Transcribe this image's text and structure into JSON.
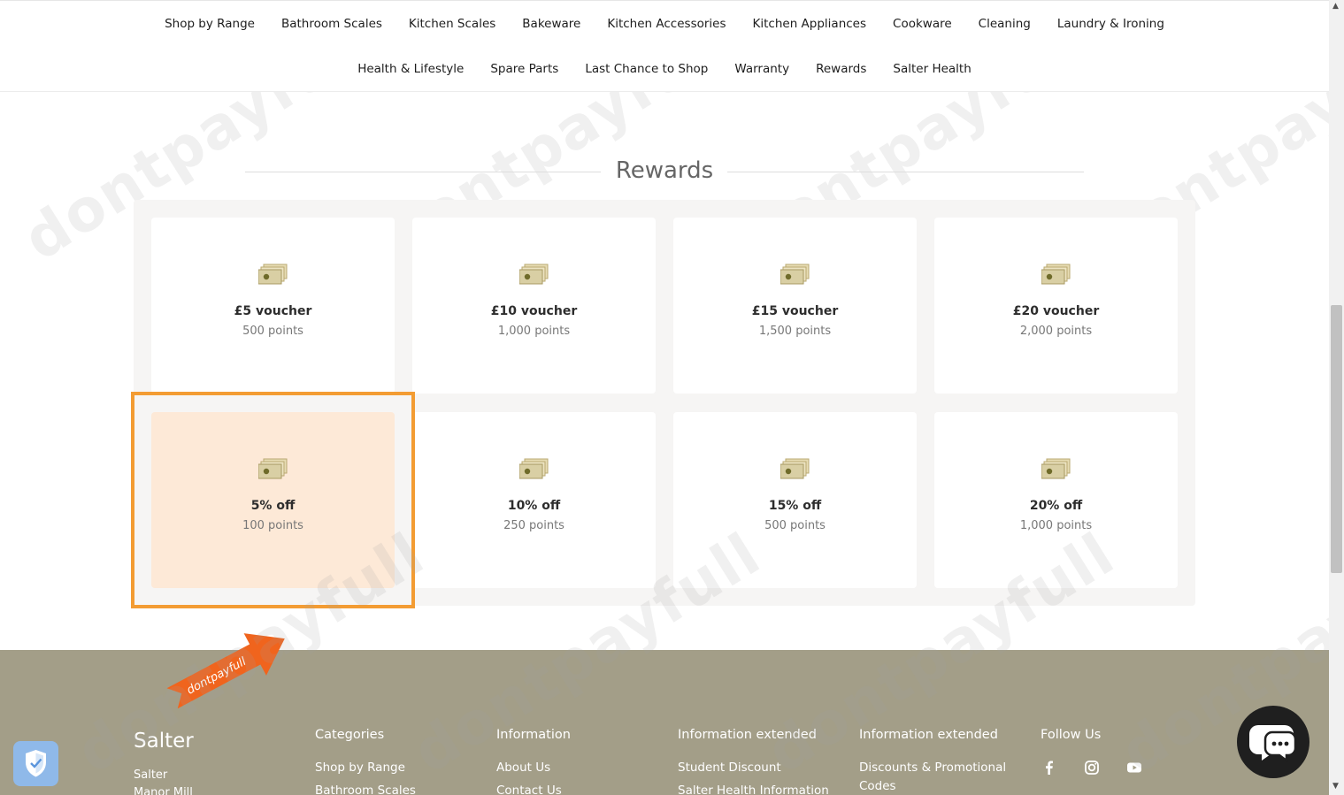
{
  "nav": {
    "row1": [
      "Shop by Range",
      "Bathroom Scales",
      "Kitchen Scales",
      "Bakeware",
      "Kitchen Accessories",
      "Kitchen Appliances",
      "Cookware",
      "Cleaning",
      "Laundry & Ironing"
    ],
    "row2": [
      "Health & Lifestyle",
      "Spare Parts",
      "Last Chance to Shop",
      "Warranty",
      "Rewards",
      "Salter Health"
    ]
  },
  "rewards": {
    "heading": "Rewards",
    "items": [
      {
        "title": "£5 voucher",
        "points": "500 points"
      },
      {
        "title": "£10 voucher",
        "points": "1,000 points"
      },
      {
        "title": "£15 voucher",
        "points": "1,500 points"
      },
      {
        "title": "£20 voucher",
        "points": "2,000 points"
      },
      {
        "title": "5% off",
        "points": "100 points"
      },
      {
        "title": "10% off",
        "points": "250 points"
      },
      {
        "title": "15% off",
        "points": "500 points"
      },
      {
        "title": "20% off",
        "points": "1,000 points"
      }
    ],
    "icon": "cash-icon"
  },
  "overlay": {
    "watermark": "dontpayfull",
    "badge_text": "dontpayfull",
    "highlight_color": "#f39c33"
  },
  "footer": {
    "brand": "Salter",
    "brand_line1": "Salter",
    "brand_line2": "Manor Mill",
    "columns": [
      {
        "heading": "Categories",
        "links": [
          "Shop by Range",
          "Bathroom Scales"
        ]
      },
      {
        "heading": "Information",
        "links": [
          "About Us",
          "Contact Us"
        ]
      },
      {
        "heading": "Information extended",
        "links": [
          "Student Discount",
          "Salter Health Information"
        ]
      },
      {
        "heading": "Information extended",
        "links": [
          "Discounts & Promotional Codes"
        ]
      }
    ],
    "follow_heading": "Follow Us",
    "social": [
      "facebook-icon",
      "instagram-icon",
      "youtube-icon"
    ]
  }
}
